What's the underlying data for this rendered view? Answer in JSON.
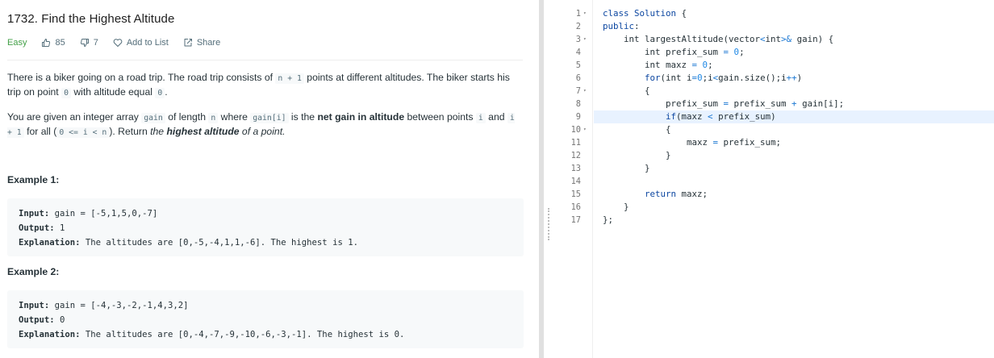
{
  "problem": {
    "title": "1732. Find the Highest Altitude",
    "difficulty": "Easy",
    "likes": "85",
    "dislikes": "7",
    "add_to_list": "Add to List",
    "share": "Share"
  },
  "description": {
    "p1_a": "There is a biker going on a road trip. The road trip consists of ",
    "p1_code1": "n + 1",
    "p1_b": " points at different altitudes. The biker starts his trip on point ",
    "p1_code2": "0",
    "p1_c": " with altitude equal ",
    "p1_code3": "0",
    "p1_d": ".",
    "p2_a": "You are given an integer array ",
    "p2_code1": "gain",
    "p2_b": " of length ",
    "p2_code2": "n",
    "p2_c": " where ",
    "p2_code3": "gain[i]",
    "p2_d": " is the ",
    "p2_bold1": "net gain in altitude",
    "p2_e": " between points ",
    "p2_code4": "i",
    "p2_f": " and ",
    "p2_code5": "i + 1",
    "p2_g": " for all (",
    "p2_code6": "0 <= i < n",
    "p2_h": "). Return ",
    "p2_italic1": "the ",
    "p2_bolditalic": "highest altitude",
    "p2_italic2": " of a point.",
    "p2_end": ""
  },
  "examples": [
    {
      "heading": "Example 1:",
      "input_label": "Input:",
      "input": " gain = [-5,1,5,0,-7]",
      "output_label": "Output:",
      "output": " 1",
      "explanation_label": "Explanation:",
      "explanation": " The altitudes are [0,-5,-4,1,1,-6]. The highest is 1."
    },
    {
      "heading": "Example 2:",
      "input_label": "Input:",
      "input": " gain = [-4,-3,-2,-1,4,3,2]",
      "output_label": "Output:",
      "output": " 0",
      "explanation_label": "Explanation:",
      "explanation": " The altitudes are [0,-4,-7,-9,-10,-6,-3,-1]. The highest is 0."
    }
  ],
  "editor": {
    "line_numbers": [
      "1",
      "2",
      "3",
      "4",
      "5",
      "6",
      "7",
      "8",
      "9",
      "10",
      "11",
      "12",
      "13",
      "14",
      "15",
      "16",
      "17"
    ],
    "fold_marker": "▾"
  },
  "colors": {
    "easy": "#43a047",
    "keyword": "#0d47a1",
    "operator": "#1976d2",
    "active_line": "#e8f2ff",
    "example_bg": "#f7f9fa"
  }
}
